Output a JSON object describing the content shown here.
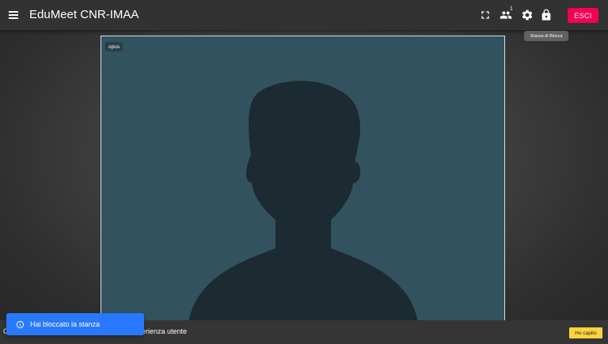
{
  "topbar": {
    "app_title": "EduMeet CNR-IMAA",
    "participants_count": "1",
    "leave_label": "ESCI",
    "tooltip": "Stanza di Blocca"
  },
  "video": {
    "codec_label": "opus"
  },
  "cookie_bar": {
    "text": "perienza utente",
    "leading_char": "C",
    "accept_label": "Ho capito"
  },
  "snackbar": {
    "message": "Hai bloccato la stanza"
  },
  "colors": {
    "topbar": "#323232",
    "leave_button": "#f50057",
    "video_tile": "#335260",
    "silhouette": "#1c2a31",
    "snackbar": "#2979ff",
    "accept_button": "#ffd33d"
  },
  "icons": [
    "menu-icon",
    "fullscreen-icon",
    "participants-icon",
    "settings-icon",
    "lock-icon",
    "info-icon"
  ]
}
